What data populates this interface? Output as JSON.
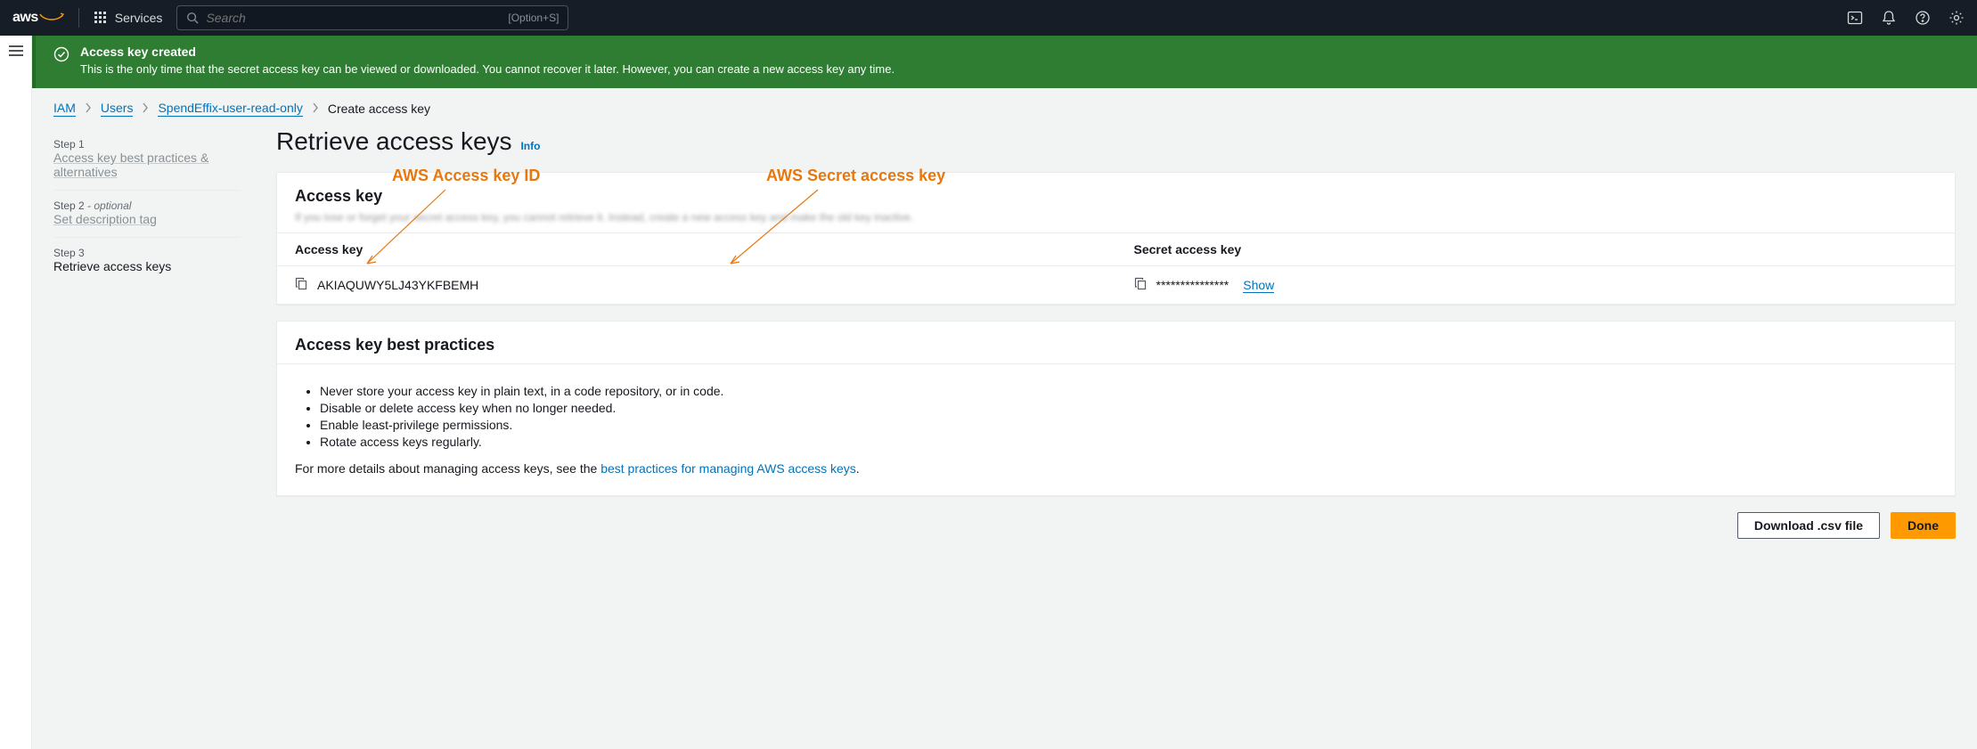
{
  "nav": {
    "services": "Services",
    "search_placeholder": "Search",
    "kbd": "[Option+S]"
  },
  "flash": {
    "title": "Access key created",
    "desc": "This is the only time that the secret access key can be viewed or downloaded. You cannot recover it later. However, you can create a new access key any time."
  },
  "crumbs": {
    "iam": "IAM",
    "users": "Users",
    "user": "SpendEffix-user-read-only",
    "current": "Create access key"
  },
  "steps": {
    "s1_label": "Step 1",
    "s1_title": "Access key best practices & alternatives",
    "s2_label": "Step 2",
    "s2_opt": " - optional",
    "s2_title": "Set description tag",
    "s3_label": "Step 3",
    "s3_title": "Retrieve access keys"
  },
  "page": {
    "title": "Retrieve access keys",
    "info": "Info"
  },
  "annotations": {
    "access_id": "AWS Access key ID",
    "secret": "AWS Secret access key"
  },
  "keypanel": {
    "header": "Access key",
    "blur": "If you lose or forget your secret access key, you cannot retrieve it. Instead, create a new access key and make the old key inactive.",
    "col1": "Access key",
    "col2": "Secret access key",
    "access_key": "AKIAQUWY5LJ43YKFBEMH",
    "secret_mask": "***************",
    "show": "Show"
  },
  "practices": {
    "header": "Access key best practices",
    "b1": "Never store your access key in plain text, in a code repository, or in code.",
    "b2": "Disable or delete access key when no longer needed.",
    "b3": "Enable least-privilege permissions.",
    "b4": "Rotate access keys regularly.",
    "more_pre": "For more details about managing access keys, see the ",
    "more_link": "best practices for managing AWS access keys",
    "more_post": "."
  },
  "buttons": {
    "download": "Download .csv file",
    "done": "Done"
  }
}
